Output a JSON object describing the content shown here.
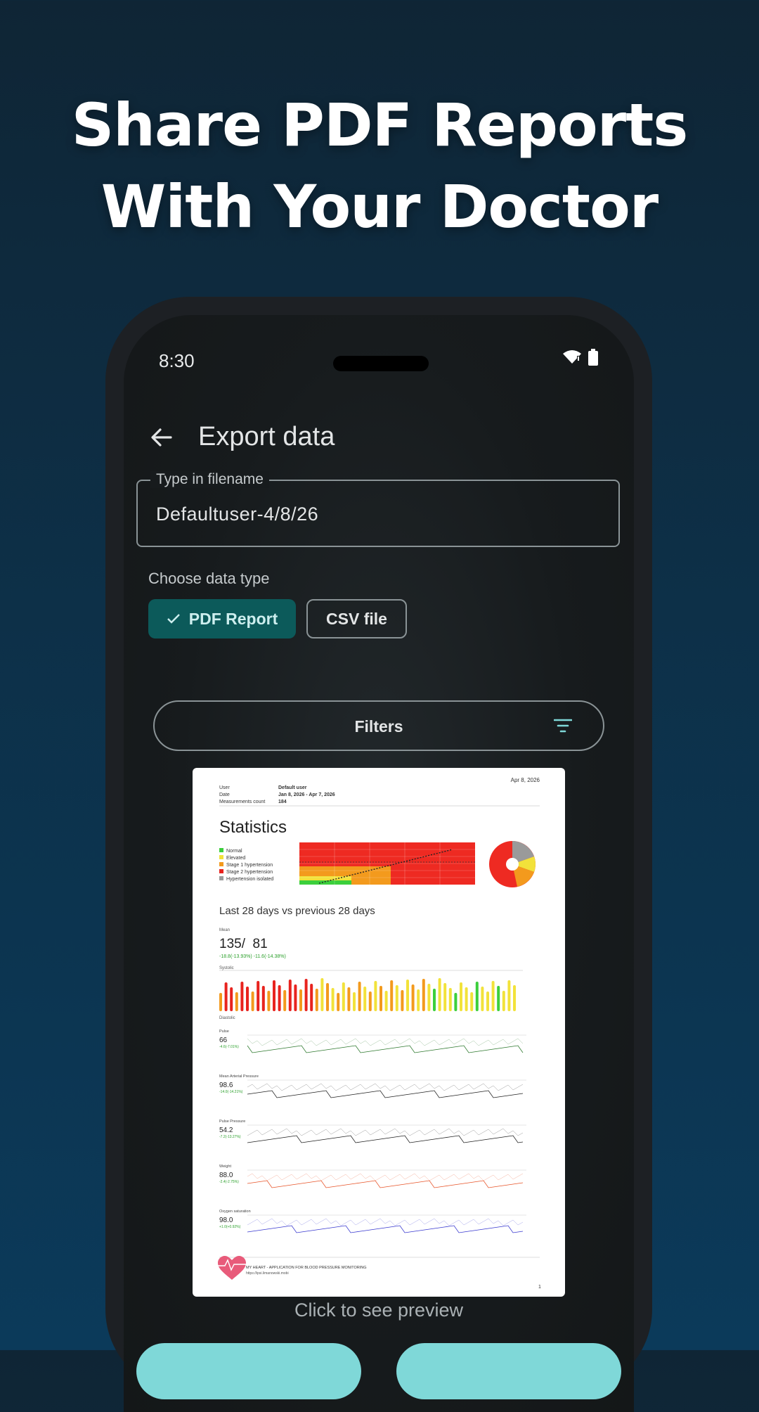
{
  "headline": {
    "line1": "Share PDF Reports",
    "line2": "With Your Doctor"
  },
  "status_bar": {
    "time": "8:30",
    "icons": [
      "wifi-icon",
      "battery-icon"
    ]
  },
  "app_bar": {
    "back_icon": "arrow-left-icon",
    "title": "Export data"
  },
  "filename_field": {
    "label": "Type in filename",
    "value": "Defaultuser-4/8/26"
  },
  "data_type": {
    "label": "Choose data type",
    "options": [
      {
        "label": "PDF Report",
        "selected": true
      },
      {
        "label": "CSV file",
        "selected": false
      }
    ]
  },
  "filters": {
    "label": "Filters",
    "icon": "filter-icon"
  },
  "report_preview": {
    "date": "Apr 8, 2026",
    "meta_labels": [
      "User",
      "Date",
      "Measurements count"
    ],
    "meta_values": [
      "Default user",
      "Jan 8, 2026 - Apr 7, 2026",
      "184"
    ],
    "statistics_title": "Statistics",
    "legend": [
      "Normal",
      "Elevated",
      "Stage 1 hypertension",
      "Stage 2 hypertension",
      "Hypertension isolated"
    ],
    "legend_colors": [
      "#3ccf3c",
      "#f2e23a",
      "#f39a1d",
      "#e8231e",
      "#9a9a9a"
    ],
    "comparison_title": "Last 28 days vs previous 28 days",
    "mean_label": "Mean",
    "mean_value": "135/  81",
    "mean_change": "-18.8(-13.93%) -11.6(-14.38%)",
    "systolic_label": "Systolic",
    "diastolic_label": "Diastolic",
    "metrics": [
      {
        "name": "Pulse",
        "value": "66",
        "change": "-4.6(-7.01%)"
      },
      {
        "name": "Mean Arterial Pressure",
        "value": "98.6",
        "change": "-14.0(-14.21%)"
      },
      {
        "name": "Pulse Pressure",
        "value": "54.2",
        "change": "-7.2(-13.27%)"
      },
      {
        "name": "Weight",
        "value": "88.0",
        "change": "-2.4(-2.75%)"
      },
      {
        "name": "Oxygen saturation",
        "value": "98.0",
        "change": "+1.0(+0.92%)"
      }
    ],
    "footer_app": "MY HEART - APPLICATION FOR BLOOD PRESSURE MONITORING",
    "footer_url": "https://ipsi.limanowski.mobi",
    "page_number": "1"
  },
  "preview_caption": "Click to see preview",
  "colors": {
    "accent": "#7fd8d8",
    "chip_selected": "#0c5a5a"
  }
}
